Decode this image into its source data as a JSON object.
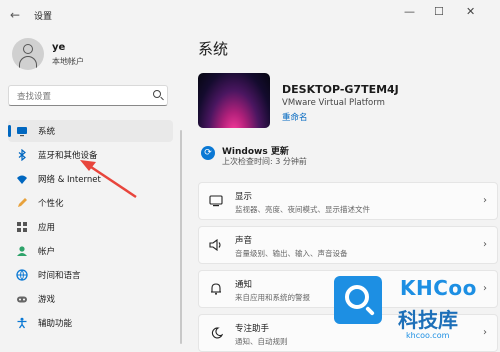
{
  "window": {
    "title": "设置",
    "back_glyph": "←",
    "min_glyph": "—",
    "max_glyph": "☐",
    "close_glyph": "✕"
  },
  "user": {
    "name": "ye",
    "account_type": "本地帐户"
  },
  "search": {
    "placeholder": "查找设置"
  },
  "nav": [
    {
      "label": "系统",
      "icon": "system-icon",
      "active": true
    },
    {
      "label": "蓝牙和其他设备",
      "icon": "bluetooth-icon",
      "active": false
    },
    {
      "label": "网络 & Internet",
      "icon": "wifi-icon",
      "active": false
    },
    {
      "label": "个性化",
      "icon": "pen-icon",
      "active": false
    },
    {
      "label": "应用",
      "icon": "apps-icon",
      "active": false
    },
    {
      "label": "帐户",
      "icon": "account-icon",
      "active": false
    },
    {
      "label": "时间和语言",
      "icon": "globe-icon",
      "active": false
    },
    {
      "label": "游戏",
      "icon": "gamepad-icon",
      "active": false
    },
    {
      "label": "辅助功能",
      "icon": "accessibility-icon",
      "active": false
    }
  ],
  "main": {
    "title": "系统",
    "device_name": "DESKTOP-G7TEM4J",
    "device_platform": "VMware Virtual Platform",
    "rename_label": "重命名",
    "update": {
      "title": "Windows 更新",
      "subtitle": "上次检查时间: 3 分钟前"
    },
    "cards": [
      {
        "title": "显示",
        "subtitle": "监视器、亮度、夜间模式、显示描述文件",
        "icon": "monitor-icon"
      },
      {
        "title": "声音",
        "subtitle": "音量级别、输出、输入、声音设备",
        "icon": "speaker-icon"
      },
      {
        "title": "通知",
        "subtitle": "来自应用和系统的警报",
        "icon": "bell-icon"
      },
      {
        "title": "专注助手",
        "subtitle": "通知、自动规则",
        "icon": "moon-icon"
      }
    ]
  },
  "watermark": {
    "brand": "KHCoo",
    "name": "科技库",
    "url": "khcoo.com"
  },
  "colors": {
    "accent": "#0067c0",
    "watermark": "#1d8fe3",
    "arrow": "#e8453c"
  }
}
